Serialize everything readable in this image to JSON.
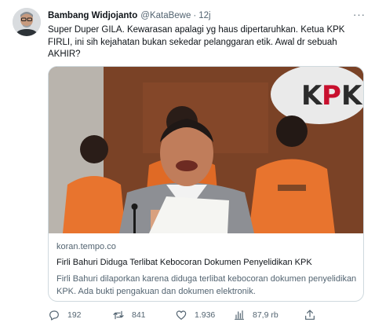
{
  "tweet": {
    "author_name": "Bambang Widjojanto",
    "handle": "@KataBewe",
    "separator": "·",
    "time": "12j",
    "more_label": "···",
    "text": "Super Duper GILA. Kewarasan apalagi yg haus dipertaruhkan. Ketua KPK FIRLI, ini sih kejahatan bukan sekedar pelanggaran etik. Awal dr sebuah AKHIR?",
    "card": {
      "domain": "koran.tempo.co",
      "title": "Firli Bahuri Diduga Terlibat Kebocoran Dokumen Penyelidikan KPK",
      "description": "Firli Bahuri dilaporkan karena diduga terlibat kebocoran dokumen penyelidikan KPK. Ada bukti pengakuan dan dokumen elektronik.",
      "image_sign_text": "KPK"
    },
    "actions": {
      "replies": "192",
      "retweets": "841",
      "likes": "1.936",
      "views": "87,9 rb"
    },
    "icons": [
      "reply-icon",
      "retweet-icon",
      "like-icon",
      "views-icon",
      "share-icon",
      "more-icon"
    ],
    "colors": {
      "text": "#0f1419",
      "secondary": "#536471",
      "border": "#cfd9de"
    }
  }
}
